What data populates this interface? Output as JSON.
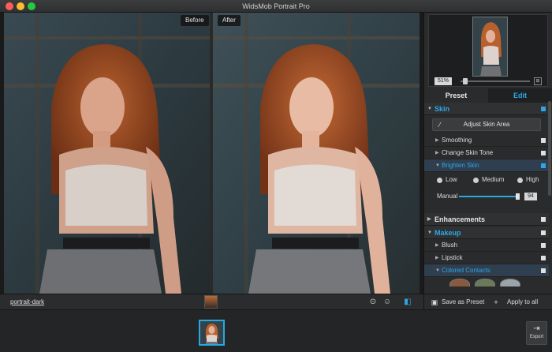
{
  "window": {
    "title": "WidsMob Portrait Pro"
  },
  "viewer": {
    "before_label": "Before",
    "after_label": "After",
    "filename": "portrait-dark"
  },
  "navigator": {
    "zoom": "51%"
  },
  "tabs": [
    {
      "label": "Preset",
      "active": false
    },
    {
      "label": "Edit",
      "active": true
    }
  ],
  "panel": {
    "skin": {
      "label": "Skin",
      "adjust_button": "Adjust Skin Area",
      "items": [
        {
          "label": "Smoothing"
        },
        {
          "label": "Change Skin Tone"
        },
        {
          "label": "Brighten Skin"
        }
      ],
      "levels": [
        "Low",
        "Medium",
        "High"
      ],
      "manual_label": "Manual",
      "manual_value": "94",
      "manual_level": 0.94
    },
    "enhancements": {
      "label": "Enhancements"
    },
    "makeup": {
      "label": "Makeup",
      "items": [
        {
          "label": "Blush"
        },
        {
          "label": "Lipstick"
        },
        {
          "label": "Colored Contacts"
        }
      ]
    },
    "footer": {
      "save_preset": "Save as Preset",
      "apply_all": "Apply to all"
    }
  },
  "export": {
    "label": "Export"
  },
  "colors": {
    "accent": "#2ea6e6",
    "panel": "#2a2b2d",
    "background": "#1f2022"
  }
}
